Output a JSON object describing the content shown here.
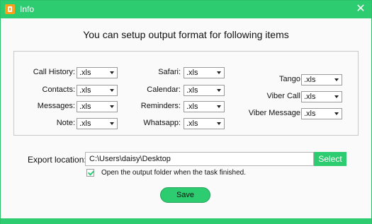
{
  "window": {
    "title": "Info",
    "close_glyph": "✕"
  },
  "heading": "You can setup output format for following items",
  "columns": [
    [
      {
        "label": "Call History:",
        "value": ".xls"
      },
      {
        "label": "Contacts:",
        "value": ".xls"
      },
      {
        "label": "Messages:",
        "value": ".xls"
      },
      {
        "label": "Note:",
        "value": ".xls"
      }
    ],
    [
      {
        "label": "Safari:",
        "value": ".xls"
      },
      {
        "label": "Calendar:",
        "value": ".xls"
      },
      {
        "label": "Reminders:",
        "value": ".xls"
      },
      {
        "label": "Whatsapp:",
        "value": ".xls"
      }
    ],
    [
      {
        "label": "Tango:",
        "value": ".xls"
      },
      {
        "label": "Viber Call:",
        "value": ".xls"
      },
      {
        "label": "Viber Message:",
        "value": ".xls"
      }
    ]
  ],
  "export": {
    "label": "Export location:",
    "path": "C:\\Users\\daisy\\Desktop",
    "select_label": "Select"
  },
  "open_folder": {
    "checked": true,
    "label": "Open the output folder when the task finished."
  },
  "save_label": "Save",
  "colors": {
    "accent": "#2ecc71",
    "icon": "#ff9f1a"
  }
}
